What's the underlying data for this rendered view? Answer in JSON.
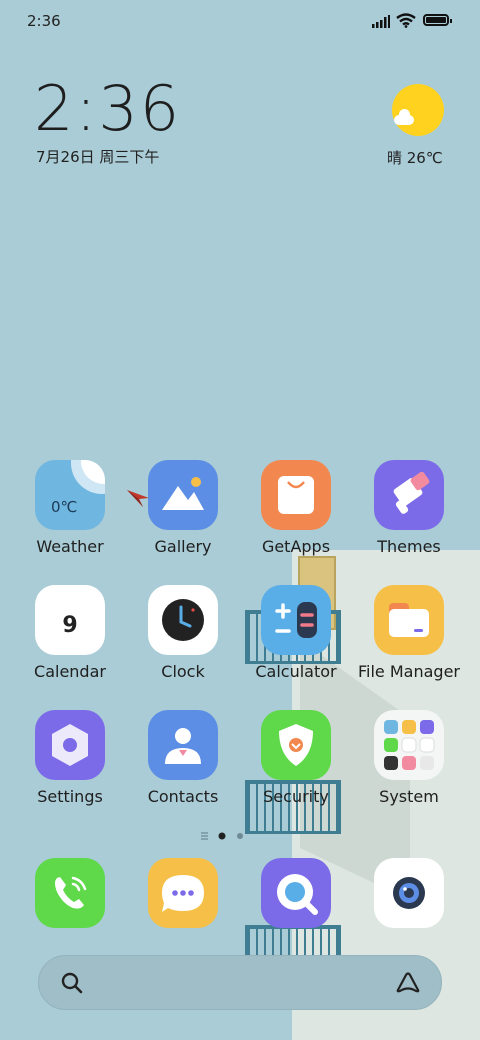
{
  "status_bar": {
    "time": "2:36"
  },
  "widget": {
    "time": "2:36",
    "date": "7月26日 周三下午",
    "weather_text": "晴 26℃",
    "weather_icon": "sunny-icon"
  },
  "apps": {
    "row1": [
      {
        "label": "Weather",
        "temp": "0℃",
        "color": "#6fb6e0"
      },
      {
        "label": "Gallery",
        "color": "#5d8ee6"
      },
      {
        "label": "GetApps",
        "color": "#f2884f"
      },
      {
        "label": "Themes",
        "color": "#7b6be8"
      }
    ],
    "row2": [
      {
        "label": "Calendar",
        "day": "9",
        "color": "#ffffff"
      },
      {
        "label": "Clock",
        "color": "#ffffff"
      },
      {
        "label": "Calculator",
        "color": "#5aaee8"
      },
      {
        "label": "File Manager",
        "color": "#f6c048"
      }
    ],
    "row3": [
      {
        "label": "Settings",
        "color": "#7b6be8"
      },
      {
        "label": "Contacts",
        "color": "#5d8ee6"
      },
      {
        "label": "Security",
        "color": "#5fd94a"
      },
      {
        "label": "System",
        "color": "#ffffff"
      }
    ],
    "dock": [
      {
        "name": "Phone",
        "color": "#5fd94a"
      },
      {
        "name": "Messaging",
        "color": "#f6c048"
      },
      {
        "name": "Browser",
        "color": "#7b6be8"
      },
      {
        "name": "Camera",
        "color": "#ffffff"
      }
    ]
  },
  "page_indicator": {
    "pages": 2,
    "current": 1
  },
  "search_bar": {
    "left_icon": "search-icon",
    "right_icon": "assistant-icon"
  }
}
